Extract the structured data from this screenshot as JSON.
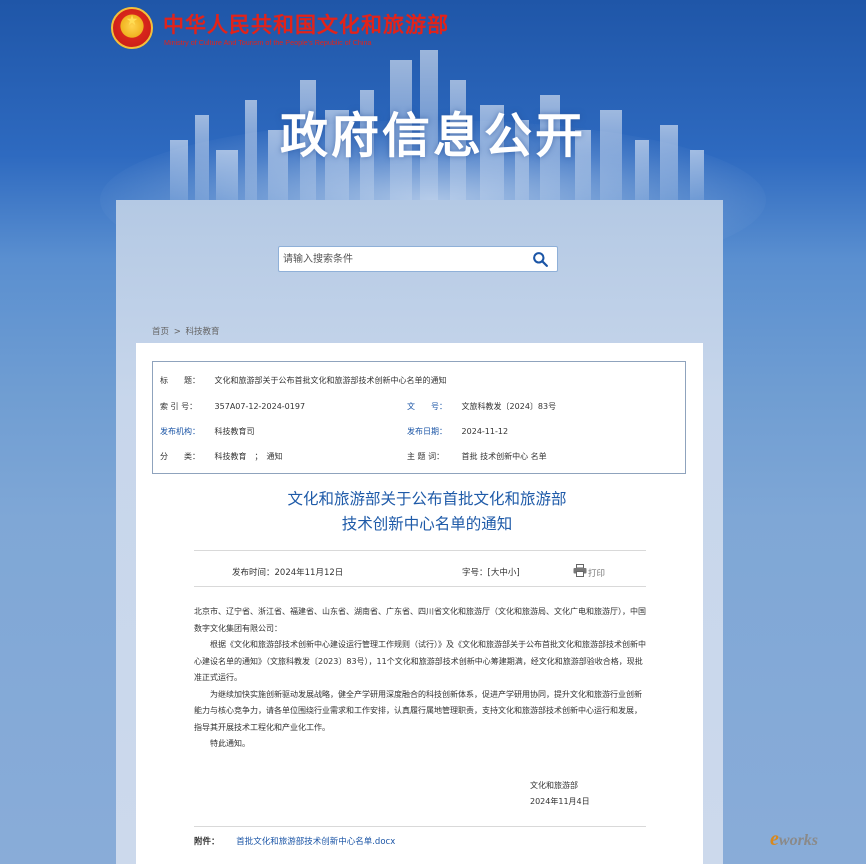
{
  "header": {
    "ministry_cn": "中华人民共和国文化和旅游部",
    "ministry_en": "Ministry of Culture And Tourism of the People’s Republic of China",
    "banner_title": "政府信息公开"
  },
  "search": {
    "placeholder": "请输入搜索条件",
    "icon": "search-icon"
  },
  "breadcrumb": {
    "home": "首页",
    "separator": ">",
    "current": "科技教育"
  },
  "meta": {
    "title_key": "标　　题：",
    "title_value": "文化和旅游部关于公布首批文化和旅游部技术创新中心名单的通知",
    "index_key": "索 引 号：",
    "index_value": "357A07-12-2024-0197",
    "docno_key": "文　　号：",
    "docno_value": "文旅科教发〔2024〕83号",
    "org_key": "发布机构：",
    "org_value": "科技教育司",
    "date_key": "发布日期：",
    "date_value": "2024-11-12",
    "cat_key": "分　　类：",
    "cat_value": "科技教育　；　通知",
    "topic_key": "主 题 词：",
    "topic_value": "首批 技术创新中心 名单"
  },
  "article": {
    "title_line1": "文化和旅游部关于公布首批文化和旅游部",
    "title_line2": "技术创新中心名单的通知",
    "publish_time": "发布时间：2024年11月12日",
    "font_size": "字号：[大中小]",
    "print": "打印",
    "para1": "北京市、辽宁省、浙江省、福建省、山东省、湖南省、广东省、四川省文化和旅游厅（文化和旅游局、文化广电和旅游厅），中国数字文化集团有限公司：",
    "para2": "根据《文化和旅游部技术创新中心建设运行管理工作规则（试行）》及《文化和旅游部关于公布首批文化和旅游部技术创新中心建设名单的通知》（文旅科教发〔2023〕83号），11个文化和旅游部技术创新中心筹建期满，经文化和旅游部验收合格，现批准正式运行。",
    "para3": "为继续加快实施创新驱动发展战略，健全产学研用深度融合的科技创新体系，促进产学研用协同，提升文化和旅游行业创新能力与核心竞争力，请各单位围绕行业需求和工作安排，认真履行属地管理职责，支持文化和旅游部技术创新中心运行和发展，指导其开展技术工程化和产业化工作。",
    "para4": "特此通知。",
    "sign_org": "文化和旅游部",
    "sign_date": "2024年11月4日",
    "attach_key": "附件：",
    "attach_value": "首批文化和旅游部技术创新中心名单.docx"
  },
  "watermark": {
    "part1": "e",
    "part2": "works"
  },
  "colors": {
    "accent": "#1e5aa8",
    "ministry_red": "#e2231a",
    "banner_bg": "#2e6ac0"
  }
}
